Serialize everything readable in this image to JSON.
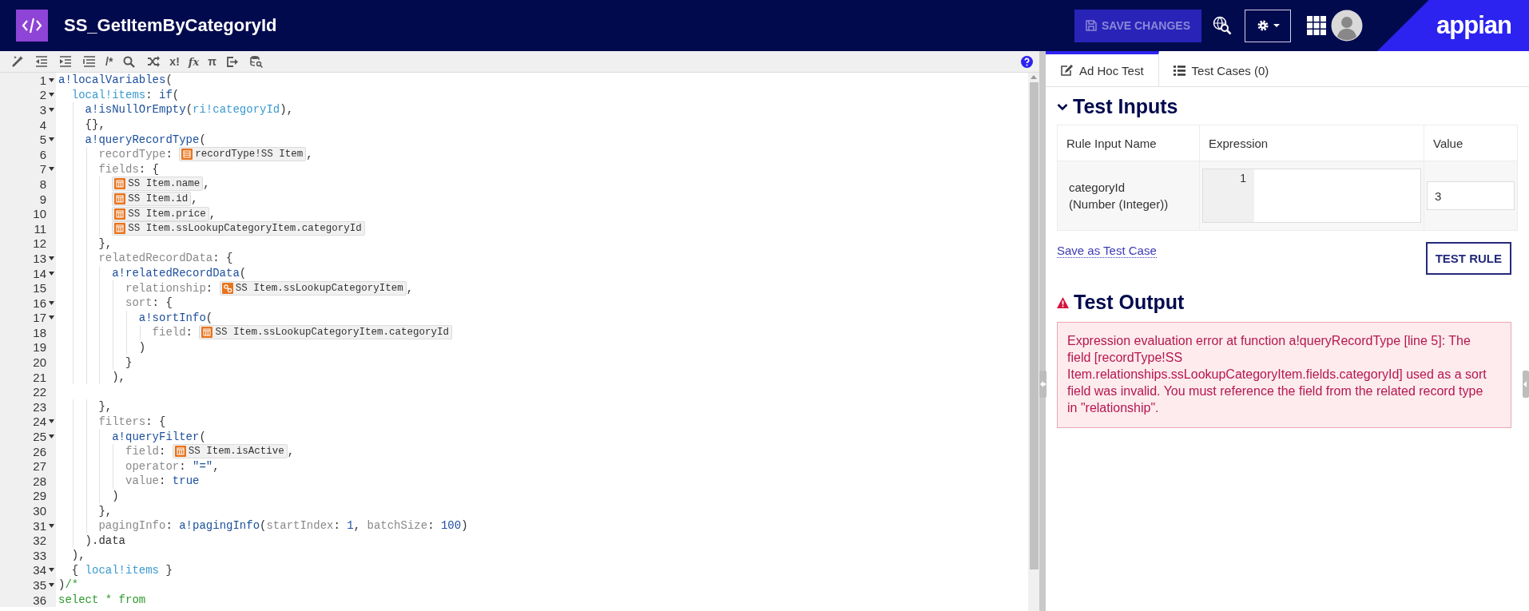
{
  "header": {
    "title": "SS_GetItemByCategoryId",
    "save_button": {
      "label": "SAVE CHANGES",
      "disabled": true
    },
    "logo": "appian"
  },
  "toolbar": [
    {
      "kind": "wand"
    },
    {
      "kind": "outdent"
    },
    {
      "kind": "indent"
    },
    {
      "kind": "lines"
    },
    {
      "kind": "glyph",
      "text": "/*"
    },
    {
      "kind": "search"
    },
    {
      "kind": "shuffle"
    },
    {
      "kind": "glyph",
      "text": "x!"
    },
    {
      "kind": "glyph",
      "text": "fx"
    },
    {
      "kind": "glyph",
      "text": "π"
    },
    {
      "kind": "export"
    },
    {
      "kind": "db-search"
    }
  ],
  "editor": {
    "lines": [
      {
        "number": "1",
        "foldable": true,
        "tokens": [
          {
            "kind": "func",
            "text": "a!localVariables"
          },
          {
            "kind": "plain",
            "text": "("
          }
        ]
      },
      {
        "number": "2",
        "foldable": true,
        "tokens": [
          {
            "kind": "var",
            "text": "  local!items"
          },
          {
            "kind": "plain",
            "text": ": "
          },
          {
            "kind": "func",
            "text": "if"
          },
          {
            "kind": "plain",
            "text": "("
          }
        ]
      },
      {
        "number": "3",
        "foldable": true,
        "tokens": [
          {
            "kind": "func",
            "text": "    a!isNullOrEmpty"
          },
          {
            "kind": "plain",
            "text": "("
          },
          {
            "kind": "var",
            "text": "ri!categoryId"
          },
          {
            "kind": "plain",
            "text": "),"
          }
        ]
      },
      {
        "number": "4",
        "foldable": false,
        "tokens": [
          {
            "kind": "plain",
            "text": "    {},"
          }
        ]
      },
      {
        "number": "5",
        "foldable": true,
        "tokens": [
          {
            "kind": "func",
            "text": "    a!queryRecordType"
          },
          {
            "kind": "plain",
            "text": "("
          }
        ]
      },
      {
        "number": "6",
        "foldable": false,
        "tokens": [
          {
            "kind": "param",
            "text": "      recordType"
          },
          {
            "kind": "plain",
            "text": ": "
          },
          {
            "kind": "record",
            "text": "recordType!SS Item"
          },
          {
            "kind": "plain",
            "text": ","
          }
        ]
      },
      {
        "number": "7",
        "foldable": true,
        "tokens": [
          {
            "kind": "param",
            "text": "      fields"
          },
          {
            "kind": "plain",
            "text": ": {"
          }
        ]
      },
      {
        "number": "8",
        "foldable": false,
        "tokens": [
          {
            "kind": "field",
            "text": "        SS Item.name"
          },
          {
            "kind": "plain",
            "text": ","
          }
        ]
      },
      {
        "number": "9",
        "foldable": false,
        "tokens": [
          {
            "kind": "field",
            "text": "        SS Item.id"
          },
          {
            "kind": "plain",
            "text": ","
          }
        ]
      },
      {
        "number": "10",
        "foldable": false,
        "tokens": [
          {
            "kind": "field",
            "text": "        SS Item.price"
          },
          {
            "kind": "plain",
            "text": ","
          }
        ]
      },
      {
        "number": "11",
        "foldable": false,
        "tokens": [
          {
            "kind": "field",
            "text": "        SS Item.ssLookupCategoryItem.categoryId"
          }
        ]
      },
      {
        "number": "12",
        "foldable": false,
        "tokens": [
          {
            "kind": "plain",
            "text": "      },"
          }
        ]
      },
      {
        "number": "13",
        "foldable": true,
        "tokens": [
          {
            "kind": "param",
            "text": "      relatedRecordData"
          },
          {
            "kind": "plain",
            "text": ": {"
          }
        ]
      },
      {
        "number": "14",
        "foldable": true,
        "tokens": [
          {
            "kind": "func",
            "text": "        a!relatedRecordData"
          },
          {
            "kind": "plain",
            "text": "("
          }
        ]
      },
      {
        "number": "15",
        "foldable": false,
        "tokens": [
          {
            "kind": "param",
            "text": "          relationship"
          },
          {
            "kind": "plain",
            "text": ": "
          },
          {
            "kind": "relationship",
            "text": "SS Item.ssLookupCategoryItem"
          },
          {
            "kind": "plain",
            "text": ","
          }
        ]
      },
      {
        "number": "16",
        "foldable": true,
        "tokens": [
          {
            "kind": "param",
            "text": "          sort"
          },
          {
            "kind": "plain",
            "text": ": {"
          }
        ]
      },
      {
        "number": "17",
        "foldable": true,
        "tokens": [
          {
            "kind": "func",
            "text": "            a!sortInfo"
          },
          {
            "kind": "plain",
            "text": "("
          }
        ]
      },
      {
        "number": "18",
        "foldable": false,
        "tokens": [
          {
            "kind": "param",
            "text": "              field"
          },
          {
            "kind": "plain",
            "text": ": "
          },
          {
            "kind": "field",
            "text": "SS Item.ssLookupCategoryItem.categoryId"
          }
        ]
      },
      {
        "number": "19",
        "foldable": false,
        "tokens": [
          {
            "kind": "plain",
            "text": "            )"
          }
        ]
      },
      {
        "number": "20",
        "foldable": false,
        "tokens": [
          {
            "kind": "plain",
            "text": "          }"
          }
        ]
      },
      {
        "number": "21",
        "foldable": false,
        "tokens": [
          {
            "kind": "plain",
            "text": "        ),"
          }
        ]
      },
      {
        "number": "22",
        "foldable": false
      },
      {
        "number": "23",
        "foldable": false,
        "tokens": [
          {
            "kind": "plain",
            "text": "      },"
          }
        ]
      },
      {
        "number": "24",
        "foldable": true,
        "tokens": [
          {
            "kind": "param",
            "text": "      filters"
          },
          {
            "kind": "plain",
            "text": ": {"
          }
        ]
      },
      {
        "number": "25",
        "foldable": true,
        "tokens": [
          {
            "kind": "func",
            "text": "        a!queryFilter"
          },
          {
            "kind": "plain",
            "text": "("
          }
        ]
      },
      {
        "number": "26",
        "foldable": false,
        "tokens": [
          {
            "kind": "param",
            "text": "          field"
          },
          {
            "kind": "plain",
            "text": ": "
          },
          {
            "kind": "field",
            "text": "SS Item.isActive"
          },
          {
            "kind": "plain",
            "text": ","
          }
        ]
      },
      {
        "number": "27",
        "foldable": false,
        "tokens": [
          {
            "kind": "param",
            "text": "          operator"
          },
          {
            "kind": "plain",
            "text": ": "
          },
          {
            "kind": "literal",
            "text": "\"=\""
          },
          {
            "kind": "plain",
            "text": ","
          }
        ]
      },
      {
        "number": "28",
        "foldable": false,
        "tokens": [
          {
            "kind": "param",
            "text": "          value"
          },
          {
            "kind": "plain",
            "text": ": "
          },
          {
            "kind": "literal",
            "text": "true"
          }
        ]
      },
      {
        "number": "29",
        "foldable": false,
        "tokens": [
          {
            "kind": "plain",
            "text": "        )"
          }
        ]
      },
      {
        "number": "30",
        "foldable": false,
        "tokens": [
          {
            "kind": "plain",
            "text": "      },"
          }
        ]
      },
      {
        "number": "31",
        "foldable": true,
        "tokens": [
          {
            "kind": "param",
            "text": "      pagingInfo"
          },
          {
            "kind": "plain",
            "text": ": "
          },
          {
            "kind": "func",
            "text": "a!pagingInfo"
          },
          {
            "kind": "plain",
            "text": "("
          },
          {
            "kind": "param",
            "text": "startIndex"
          },
          {
            "kind": "plain",
            "text": ": "
          },
          {
            "kind": "literal",
            "text": "1"
          },
          {
            "kind": "plain",
            "text": ", "
          },
          {
            "kind": "param",
            "text": "batchSize"
          },
          {
            "kind": "plain",
            "text": ": "
          },
          {
            "kind": "literal",
            "text": "100"
          },
          {
            "kind": "plain",
            "text": ")"
          }
        ]
      },
      {
        "number": "32",
        "foldable": false,
        "tokens": [
          {
            "kind": "plain",
            "text": "    ).data"
          }
        ]
      },
      {
        "number": "33",
        "foldable": false,
        "tokens": [
          {
            "kind": "plain",
            "text": "  ),"
          }
        ]
      },
      {
        "number": "34",
        "foldable": true,
        "tokens": [
          {
            "kind": "plain",
            "text": "  { "
          },
          {
            "kind": "var",
            "text": "local!items"
          },
          {
            "kind": "plain",
            "text": " }"
          }
        ]
      },
      {
        "number": "35",
        "foldable": true,
        "tokens": [
          {
            "kind": "plain",
            "text": ")"
          },
          {
            "kind": "comment",
            "text": "/*"
          }
        ]
      },
      {
        "number": "36",
        "foldable": false,
        "tokens": [
          {
            "kind": "comment",
            "text": "select * from"
          }
        ]
      }
    ]
  },
  "test_panel": {
    "tabs": [
      {
        "kind": "pencil",
        "label": "Ad Hoc Test",
        "selected": true
      },
      {
        "kind": "list",
        "label": "Test Cases (0)",
        "selected": false
      }
    ],
    "inputs": {
      "heading": "Test Inputs",
      "expanded": true,
      "table": {
        "columns": [
          "Rule Input Name",
          "Expression",
          "Value"
        ],
        "rows": [
          {
            "name": "categoryId",
            "type": "(Number (Integer))",
            "expression_line": "1",
            "value": "3"
          }
        ]
      },
      "save_link": "Save as Test Case",
      "test_button": "TEST RULE"
    },
    "output": {
      "heading": "Test Output",
      "error": "Expression evaluation error at function a!queryRecordType [line 5]: The field [recordType!SS Item.relationships.ssLookupCategoryItem.fields.categoryId] used as a sort field was invalid. You must reference the field from the related record type in \"relationship\"."
    }
  }
}
